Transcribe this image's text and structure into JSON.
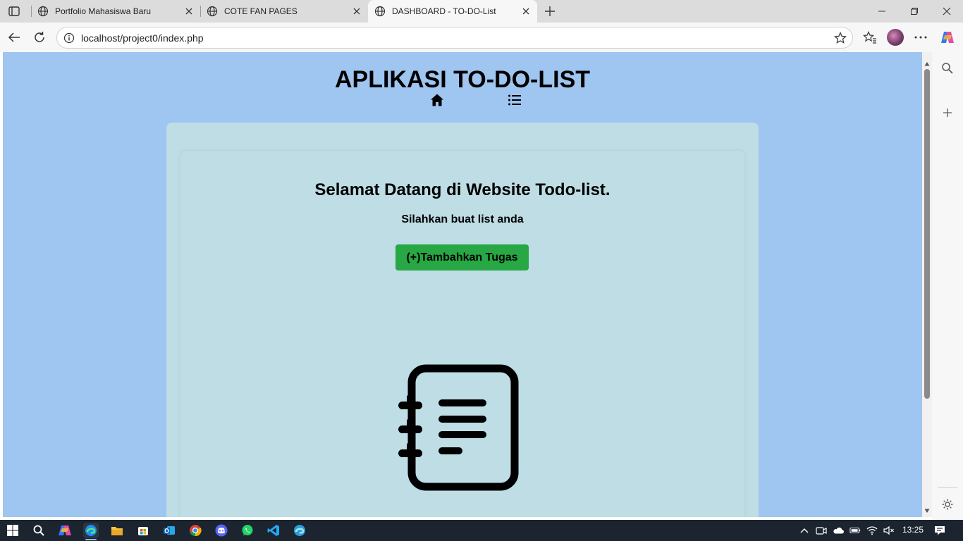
{
  "browser": {
    "tabs": [
      {
        "title": "Portfolio Mahasiswa Baru",
        "active": false
      },
      {
        "title": "COTE FAN PAGES",
        "active": false
      },
      {
        "title": "DASHBOARD - TO-DO-List",
        "active": true
      }
    ],
    "url": "localhost/project0/index.php"
  },
  "page": {
    "site_title": "APLIKASI TO-DO-LIST",
    "nav_items": [
      {
        "icon": "home-icon"
      },
      {
        "icon": "list-icon"
      }
    ],
    "welcome_heading": "Selamat Datang di Website Todo-list.",
    "subtitle": "Silahkan buat list anda",
    "add_task_button": "(+)Tambahkan Tugas",
    "illustration": "notepad-list-icon"
  },
  "taskbar": {
    "clock": "13:25",
    "apps": [
      "start-icon",
      "search-icon",
      "copilot-icon",
      "edge-icon",
      "file-explorer-icon",
      "store-icon",
      "outlook-icon",
      "chrome-icon",
      "discord-icon",
      "whatsapp-icon",
      "vscode-icon",
      "edge-dev-icon"
    ]
  },
  "colors": {
    "page_background": "#9fc5f1",
    "card_background": "#bedde5",
    "add_button": "#27a844",
    "taskbar": "#1c2430"
  }
}
